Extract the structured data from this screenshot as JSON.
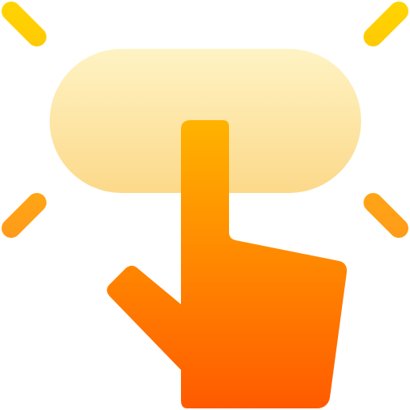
{
  "icon": {
    "name": "tap-button-icon",
    "colors": {
      "button_top": "#fef3c4",
      "button_bottom": "#fcd98a",
      "hand_top": "#ffb300",
      "hand_bottom": "#ff5a00",
      "ray_top": "#ffd500",
      "ray_bottom": "#ff9a1a"
    },
    "parts": [
      "button-pill",
      "pointing-hand",
      "spark-rays"
    ]
  }
}
